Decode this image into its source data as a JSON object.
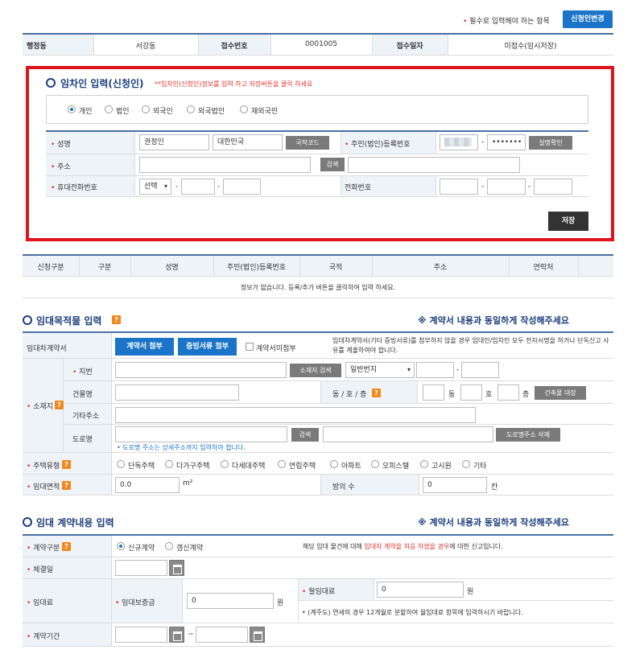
{
  "top": {
    "required_note": "필수로 입력해야 하는 항목",
    "change_button": "신청인변경"
  },
  "info_row": {
    "label1": "행정동",
    "value1": "서강동",
    "label2": "접수번호",
    "value2": "0001005",
    "label3": "접수일자",
    "value3": "미접수(임시저장)"
  },
  "tenant": {
    "title": "임차인 입력(신청인)",
    "notice": "**임차인(신청인)정보를 입력 하고 저장버튼을 클릭 하세요",
    "types": [
      "개인",
      "법인",
      "외국인",
      "외국법인",
      "재외국민"
    ],
    "selected_type": "개인",
    "name_label": "성명",
    "name_value": "권정인",
    "country_value": "대한민국",
    "country_code_button": "국적코드",
    "regno_label": "주민(법인)등록번호",
    "regno_dash": "-",
    "regno_back": "•••••••",
    "verify_button": "실명확인",
    "address_label": "주소",
    "search_button": "검색",
    "mobile_label": "휴대전화번호",
    "mobile_select": "선택",
    "phone_label": "전화번호",
    "save_button": "저장"
  },
  "list_table": {
    "headers": [
      "신청구분",
      "구분",
      "성명",
      "주민(법인)등록번호",
      "국적",
      "주소",
      "연락처"
    ],
    "empty_message": "정보가 없습니다.  등록/추가 버튼을 클릭하여 입력 하세요."
  },
  "property": {
    "title": "임대목적물 입력",
    "notice": "※ 계약서 내용과 동일하게 작성해주세요",
    "contract_label": "임대차계약서",
    "attach_contract": "계약서 첨부",
    "attach_proof": "증빙서류 첨부",
    "no_contract": "계약서미첨부",
    "contract_note": "임대차계약서(기타 증빙서류)를 첨부하지 않을 경우 임대인/임차인 모두 전자서명을 하거나 단독신고 사유를 계출하여야 합니다.",
    "location_label": "소재지",
    "lot_label": "지번",
    "location_search": "소재지 검색",
    "lot_type": "일반번지",
    "building_label": "건물명",
    "dong_ho_label": "동 / 호 / 층",
    "dong": "동",
    "ho": "호",
    "floor": "층",
    "building_lookup": "건축물 대장",
    "other_address_label": "기타주소",
    "road_label": "도로명",
    "road_search": "검색",
    "road_delete": "도로명주소 삭제",
    "road_note": "• 도로명 주소는 상세주소까지 입력하야 합니다.",
    "housing_type_label": "주택유형",
    "housing_types": [
      "단독주택",
      "다가구주택",
      "다세대주택",
      "연립주택",
      "아파트",
      "오피스텔",
      "고시원",
      "기타"
    ],
    "area_label": "임대면적",
    "area_value": "0.0",
    "area_unit": "m²",
    "rooms_label": "방의 수",
    "rooms_value": "0",
    "rooms_unit": "칸"
  },
  "contract": {
    "title": "임대 계약내용 입력",
    "notice": "※ 계약서 내용과 동일하게 작성해주세요",
    "type_label": "계약구분",
    "types": [
      "신규계약",
      "갱신계약"
    ],
    "selected_type": "신규계약",
    "type_note_pre": "해당 임대 물건에 대해 ",
    "type_note_red": "임대차 계약을 처음 하셨을 경우",
    "type_note_post": "에 대한 신고입니다.",
    "date_label": "체결일",
    "rent_label": "임대료",
    "deposit_label": "임대보증금",
    "deposit_value": "0",
    "won": "원",
    "monthly_label": "월임대료",
    "monthly_value": "0",
    "monthly_note": "• (계주도) 연세의 경우 12개월로 분할하여 월임대료 항목에 입력하시기 바랍니다.",
    "period_label": "계약기간",
    "tilde": "~"
  },
  "colors": {
    "accent_blue": "#1a75c9",
    "title_navy": "#1b3e7e",
    "red_frame": "#e0121e",
    "required_red": "#e4322b"
  }
}
